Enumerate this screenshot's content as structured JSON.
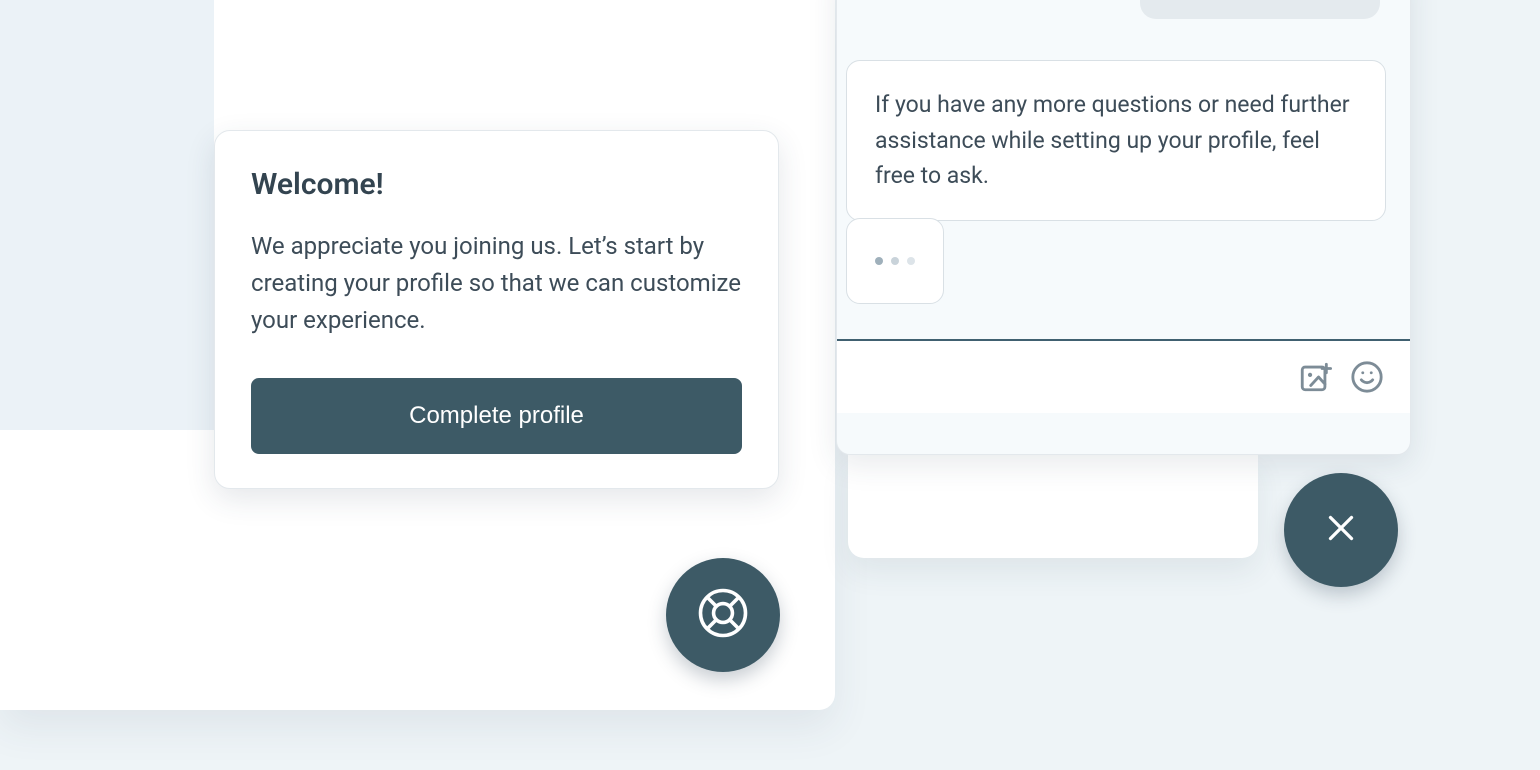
{
  "welcome": {
    "title": "Welcome!",
    "body": "We appreciate you joining us. Let’s start by creating your profile so that we can customize your experience.",
    "button_label": "Complete profile"
  },
  "chat": {
    "message": "If you have any more questions or need further assistance while setting up your profile, feel free to ask."
  },
  "colors": {
    "accent": "#3d5a66"
  }
}
